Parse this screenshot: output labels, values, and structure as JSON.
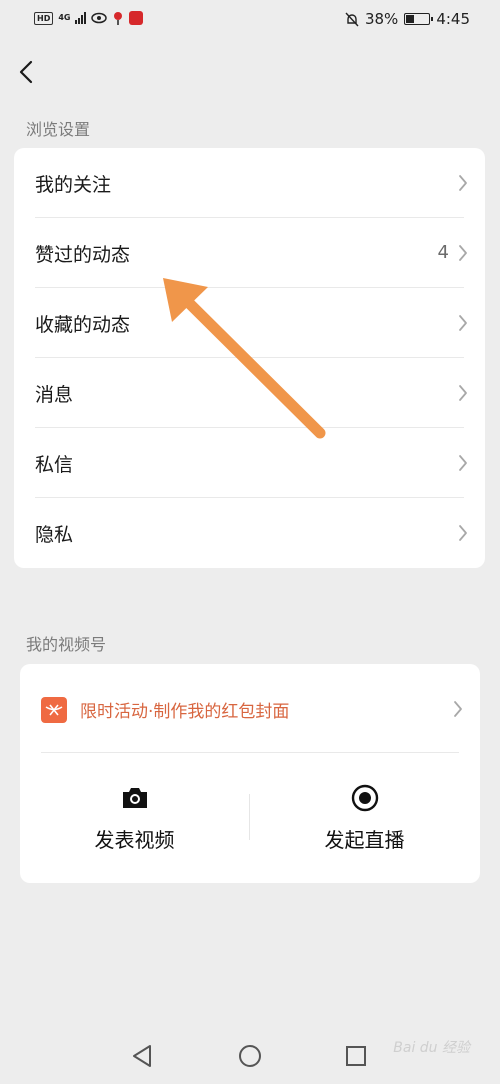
{
  "status_bar": {
    "hd": "HD",
    "network": "4G",
    "battery": "38%",
    "battery_level": 0.38,
    "time": "4:45"
  },
  "browse_settings": {
    "title": "浏览设置",
    "items": [
      {
        "label": "我的关注",
        "count": "",
        "icon": "chevron-right-icon"
      },
      {
        "label": "赞过的动态",
        "count": "4",
        "icon": "chevron-right-icon"
      },
      {
        "label": "收藏的动态",
        "count": "",
        "icon": "chevron-right-icon"
      },
      {
        "label": "消息",
        "count": "",
        "icon": "chevron-right-icon"
      },
      {
        "label": "私信",
        "count": "",
        "icon": "chevron-right-icon"
      },
      {
        "label": "隐私",
        "count": "",
        "icon": "chevron-right-icon"
      }
    ]
  },
  "channel": {
    "title": "我的视频号",
    "promo_text": "限时活动·制作我的红包封面",
    "promo_color": "#d86640",
    "actions": [
      {
        "label": "发表视频",
        "icon": "camera-icon"
      },
      {
        "label": "发起直播",
        "icon": "record-icon"
      }
    ]
  },
  "annotation": {
    "arrow_color": "#f0964a"
  },
  "nav": {
    "icons": [
      "back-triangle-icon",
      "home-circle-icon",
      "recents-square-icon"
    ]
  },
  "watermark": "Bai du 经验"
}
